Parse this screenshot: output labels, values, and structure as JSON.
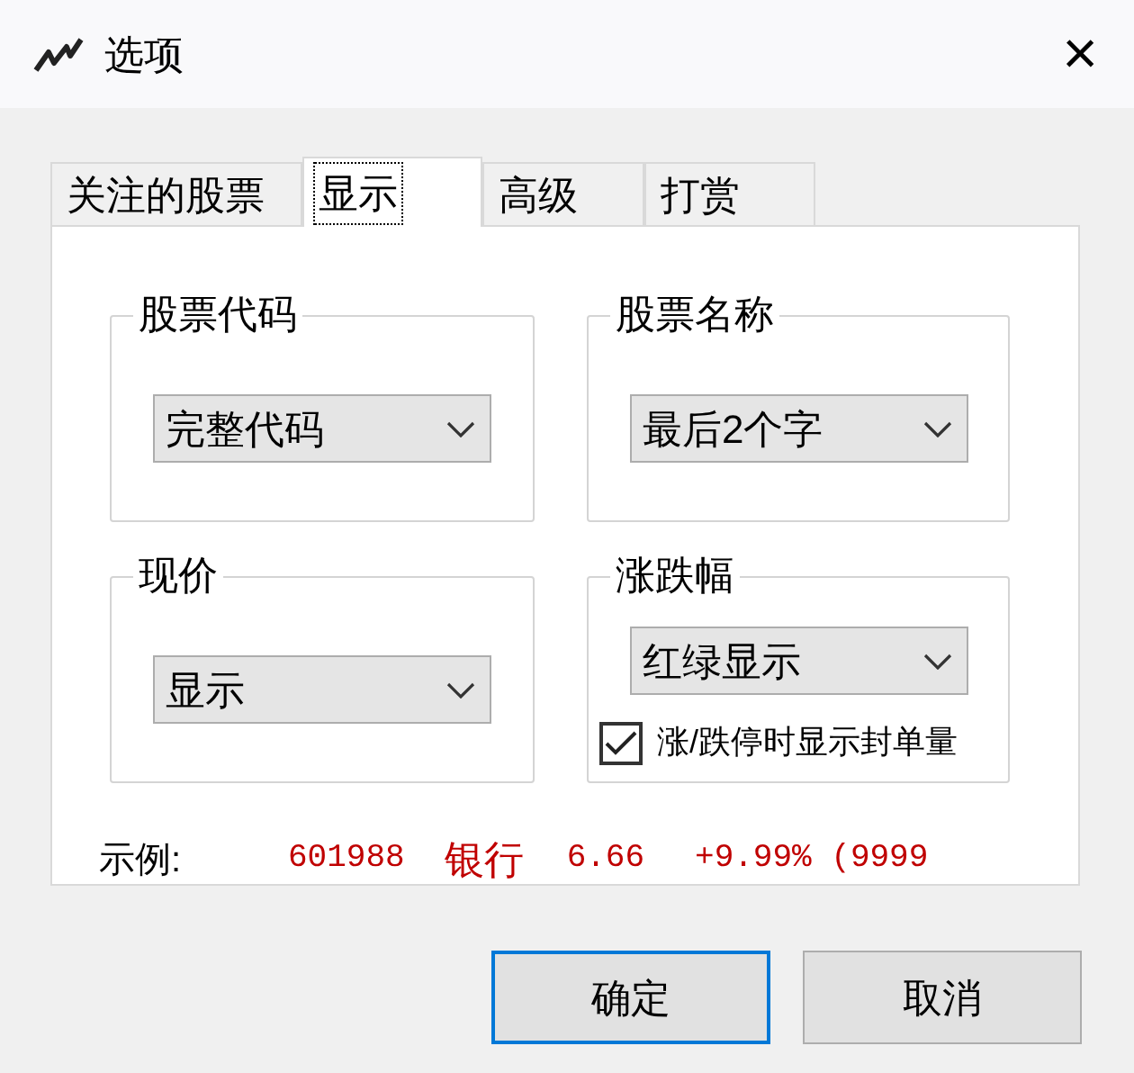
{
  "window": {
    "title": "选项",
    "close": "×"
  },
  "tabs": [
    {
      "label": "关注的股票",
      "selected": false
    },
    {
      "label": "显示",
      "selected": true
    },
    {
      "label": "高级",
      "selected": false
    },
    {
      "label": "打赏",
      "selected": false
    }
  ],
  "groups": [
    {
      "title": "股票代码",
      "value": "完整代码"
    },
    {
      "title": "股票名称",
      "value": "最后2个字"
    },
    {
      "title": "现价",
      "value": "显示"
    },
    {
      "title": "涨跌幅",
      "value": "红绿显示",
      "checkbox": {
        "label": "涨/跌停时显示封单量",
        "checked": true
      }
    }
  ],
  "example": {
    "label": "示例:",
    "values": [
      "601988",
      "银行",
      "6.66",
      "+9.99% (9999"
    ]
  },
  "buttons": [
    {
      "label": "确定",
      "default": true
    },
    {
      "label": "取消",
      "default": false
    }
  ]
}
